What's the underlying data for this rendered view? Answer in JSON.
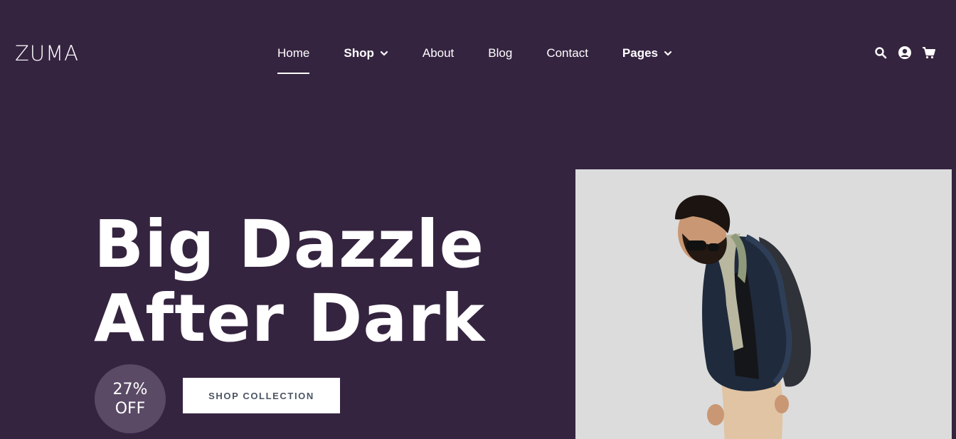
{
  "header": {
    "logo": "ZUMA",
    "nav": [
      {
        "label": "Home",
        "active": true,
        "dropdown": false
      },
      {
        "label": "Shop",
        "active": false,
        "dropdown": true
      },
      {
        "label": "About",
        "active": false,
        "dropdown": false
      },
      {
        "label": "Blog",
        "active": false,
        "dropdown": false
      },
      {
        "label": "Contact",
        "active": false,
        "dropdown": false
      },
      {
        "label": "Pages",
        "active": false,
        "dropdown": true
      }
    ],
    "icons": [
      "search-icon",
      "user-icon",
      "cart-icon"
    ]
  },
  "hero": {
    "title_line1": "Big Dazzle",
    "title_line2": "After Dark",
    "badge_percent": "27%",
    "badge_off": "OFF",
    "cta_label": "SHOP COLLECTION",
    "image_subject": "man-in-leather-jacket"
  },
  "colors": {
    "background": "#352440",
    "badge": "#5a4a66",
    "image_bg": "#dcdcdc",
    "text": "#ffffff"
  }
}
